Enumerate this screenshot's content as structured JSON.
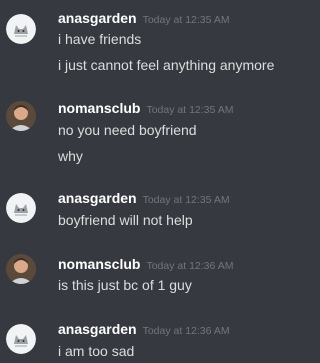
{
  "messages": [
    {
      "author": "anasgarden",
      "avatar": "cat-avatar-icon",
      "timestamp": "Today at 12:35 AM",
      "lines": [
        "i have friends",
        "i just cannot feel anything anymore"
      ]
    },
    {
      "author": "nomansclub",
      "avatar": "photo-avatar-icon",
      "timestamp": "Today at 12:35 AM",
      "lines": [
        "no you need boyfriend",
        "why"
      ]
    },
    {
      "author": "anasgarden",
      "avatar": "cat-avatar-icon",
      "timestamp": "Today at 12:35 AM",
      "lines": [
        "boyfriend will not help"
      ]
    },
    {
      "author": "nomansclub",
      "avatar": "photo-avatar-icon",
      "timestamp": "Today at 12:36 AM",
      "lines": [
        "is this just bc of 1 guy"
      ]
    },
    {
      "author": "anasgarden",
      "avatar": "cat-avatar-icon",
      "timestamp": "Today at 12:36 AM",
      "lines": [
        "i am too sad"
      ]
    }
  ],
  "colors": {
    "background": "#36393f",
    "username": "#ffffff",
    "timestamp": "#72767d",
    "text": "#dcddde"
  }
}
